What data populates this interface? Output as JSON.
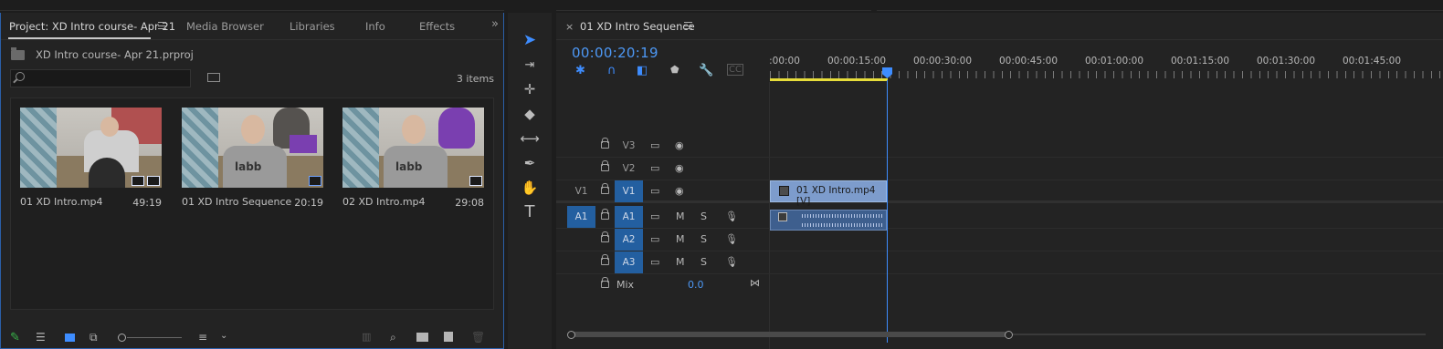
{
  "project_panel": {
    "tabs": [
      {
        "label": "Project: XD Intro course- Apr 21"
      },
      {
        "label": "Media Browser"
      },
      {
        "label": "Libraries"
      },
      {
        "label": "Info"
      },
      {
        "label": "Effects"
      }
    ],
    "overflow_icon": "double-chevron-right-icon",
    "project_file": "XD Intro course- Apr 21.prproj",
    "search_placeholder": "",
    "items_count": "3 items",
    "clips": [
      {
        "name": "01 XD Intro.mp4",
        "duration": "49:19"
      },
      {
        "name": "01 XD Intro Sequence",
        "duration": "20:19"
      },
      {
        "name": "02 XD Intro.mp4",
        "duration": "29:08"
      }
    ]
  },
  "tools": [
    "selection-tool-icon",
    "track-select-icon",
    "ripple-edit-icon",
    "razor-icon",
    "slip-icon",
    "pen-icon",
    "hand-icon",
    "type-icon"
  ],
  "sequence_panel": {
    "title": "01 XD Intro Sequence",
    "close_glyph": "×",
    "timecode": "00:00:20:19",
    "ruler_labels": [
      ":00:00",
      "00:00:15:00",
      "00:00:30:00",
      "00:00:45:00",
      "00:01:00:00",
      "00:01:15:00",
      "00:01:30:00",
      "00:01:45:00"
    ],
    "tracks": {
      "video": [
        {
          "source": "",
          "label": "V3"
        },
        {
          "source": "",
          "label": "V2"
        },
        {
          "source": "V1",
          "label": "V1"
        }
      ],
      "audio": [
        {
          "source": "A1",
          "label": "A1",
          "m": "M",
          "s": "S"
        },
        {
          "source": "",
          "label": "A2",
          "m": "M",
          "s": "S"
        },
        {
          "source": "",
          "label": "A3",
          "m": "M",
          "s": "S"
        }
      ],
      "mix_label": "Mix",
      "mix_value": "0.0"
    },
    "video_clip_name": "01 XD Intro.mp4 [V]",
    "colors": {
      "accent": "#3e8dff",
      "timecode": "#4d98f5",
      "workarea": "#e6dc3a",
      "clip_video": "#7d9ccc",
      "clip_audio": "#3e5f8e"
    }
  }
}
